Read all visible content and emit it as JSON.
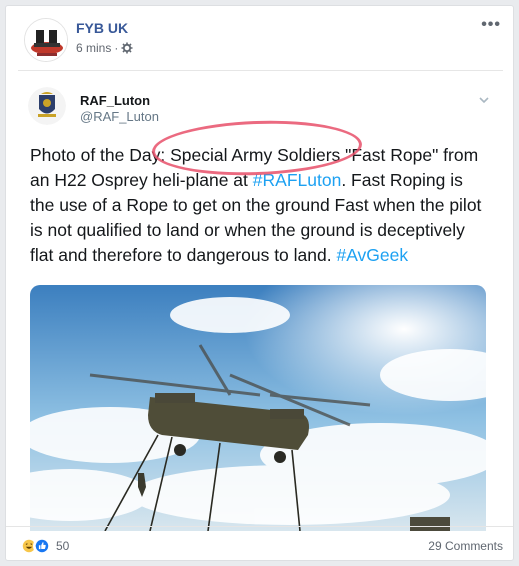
{
  "post": {
    "page_name": "FYB UK",
    "time": "6 mins",
    "separator": "·",
    "audience_icon": "gear-icon",
    "more_icon": "more-options-icon",
    "more_label": "•••"
  },
  "tweet": {
    "name": "RAF_Luton",
    "handle": "@RAF_Luton",
    "text_parts": [
      {
        "t": "Photo of the Day: Special Army Soldiers \"Fast Rope\" from an H22 Osprey heli-plane at ",
        "link": false
      },
      {
        "t": "#RAFLuton",
        "link": true
      },
      {
        "t": ". Fast Roping is the use of a Rope to get on the ground Fast when the pilot is not qualified to land or when the ground is deceptively flat and therefore to dangerous to land. ",
        "link": false
      },
      {
        "t": "#AvGeek",
        "link": true
      }
    ],
    "highlight_color": "#e8506a",
    "link_color": "#1da1f2"
  },
  "footer": {
    "reaction_icons": [
      "haha-icon",
      "like-icon"
    ],
    "reaction_count": "50",
    "comments": "29 Comments"
  },
  "colors": {
    "page_name": "#385898",
    "card_bg": "#ffffff",
    "page_bg": "#e9ebee"
  }
}
